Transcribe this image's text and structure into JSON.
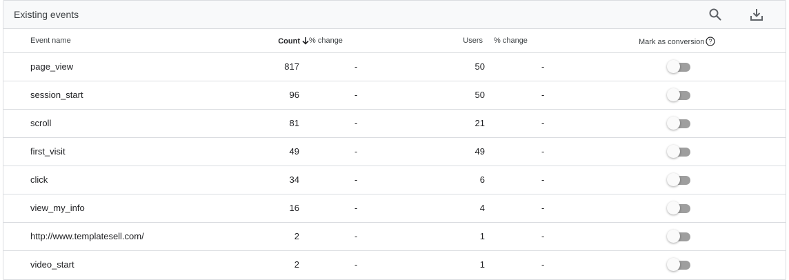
{
  "panel": {
    "title": "Existing events"
  },
  "toolbar": {
    "search_icon": "search-icon",
    "download_icon": "download-icon"
  },
  "columns": {
    "event_name": "Event name",
    "count": "Count",
    "count_change": "% change",
    "users": "Users",
    "users_change": "% change",
    "mark_as_conversion": "Mark as conversion"
  },
  "sort": {
    "column": "count",
    "direction": "descending",
    "icon": "arrow-down-icon"
  },
  "rows": [
    {
      "name": "page_view",
      "count": "817",
      "count_change": "-",
      "users": "50",
      "users_change": "-",
      "conversion": false
    },
    {
      "name": "session_start",
      "count": "96",
      "count_change": "-",
      "users": "50",
      "users_change": "-",
      "conversion": false
    },
    {
      "name": "scroll",
      "count": "81",
      "count_change": "-",
      "users": "21",
      "users_change": "-",
      "conversion": false
    },
    {
      "name": "first_visit",
      "count": "49",
      "count_change": "-",
      "users": "49",
      "users_change": "-",
      "conversion": false
    },
    {
      "name": "click",
      "count": "34",
      "count_change": "-",
      "users": "6",
      "users_change": "-",
      "conversion": false
    },
    {
      "name": "view_my_info",
      "count": "16",
      "count_change": "-",
      "users": "4",
      "users_change": "-",
      "conversion": false
    },
    {
      "name": "http://www.templatesell.com/",
      "count": "2",
      "count_change": "-",
      "users": "1",
      "users_change": "-",
      "conversion": false
    },
    {
      "name": "video_start",
      "count": "2",
      "count_change": "-",
      "users": "1",
      "users_change": "-",
      "conversion": false
    }
  ],
  "colors": {
    "border": "#dadce0",
    "titlebar_bg": "#f8f9fa",
    "toggle_off_track": "#9e9e9e",
    "text": "#202124"
  }
}
